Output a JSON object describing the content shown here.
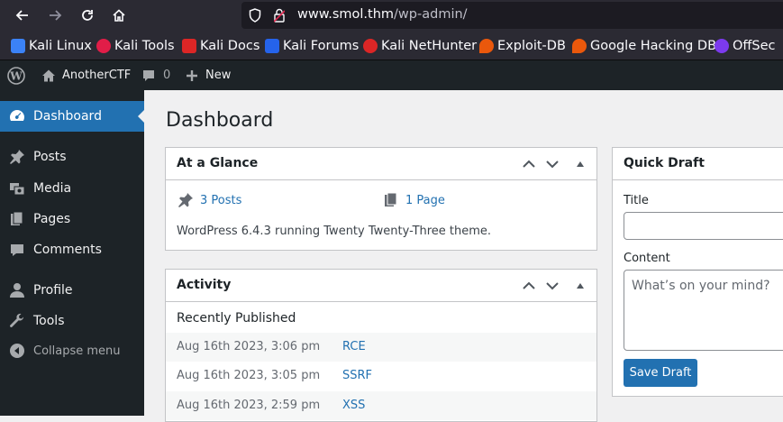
{
  "browser": {
    "url_host": "www.smol.thm",
    "url_path": "/wp-admin/",
    "bookmarks": [
      {
        "label": "Kali Linux",
        "color": "#3b82f6"
      },
      {
        "label": "Kali Tools",
        "color": "#e11d48"
      },
      {
        "label": "Kali Docs",
        "color": "#dc2626"
      },
      {
        "label": "Kali Forums",
        "color": "#2563eb"
      },
      {
        "label": "Kali NetHunter",
        "color": "#dc2626"
      },
      {
        "label": "Exploit-DB",
        "color": "#ea580c"
      },
      {
        "label": "Google Hacking DB",
        "color": "#ea580c"
      },
      {
        "label": "OffSec",
        "color": "#7c3aed"
      }
    ]
  },
  "adminbar": {
    "site_name": "AnotherCTF",
    "comments_count": "0",
    "new_label": "New"
  },
  "sidebar": {
    "items": [
      {
        "label": "Dashboard",
        "icon": "dashboard-icon",
        "active": true
      },
      {
        "label": "Posts",
        "icon": "pin-icon"
      },
      {
        "label": "Media",
        "icon": "media-icon"
      },
      {
        "label": "Pages",
        "icon": "pages-icon"
      },
      {
        "label": "Comments",
        "icon": "comment-icon"
      },
      {
        "label": "Profile",
        "icon": "user-icon"
      },
      {
        "label": "Tools",
        "icon": "wrench-icon"
      },
      {
        "label": "Collapse menu",
        "icon": "collapse-icon"
      }
    ]
  },
  "main": {
    "title": "Dashboard",
    "glance": {
      "heading": "At a Glance",
      "posts": "3 Posts",
      "pages": "1 Page",
      "version_text": "WordPress 6.4.3 running Twenty Twenty-Three theme."
    },
    "activity": {
      "heading": "Activity",
      "subheading": "Recently Published",
      "rows": [
        {
          "date": "Aug 16th 2023, 3:06 pm",
          "title": "RCE"
        },
        {
          "date": "Aug 16th 2023, 3:05 pm",
          "title": "SSRF"
        },
        {
          "date": "Aug 16th 2023, 2:59 pm",
          "title": "XSS"
        }
      ]
    },
    "quick_draft": {
      "heading": "Quick Draft",
      "title_label": "Title",
      "content_label": "Content",
      "content_placeholder": "What’s on your mind?",
      "save_label": "Save Draft"
    }
  },
  "colors": {
    "accent": "#2271b1",
    "adminbar": "#1d2327",
    "page_bg": "#f0f0f1"
  }
}
